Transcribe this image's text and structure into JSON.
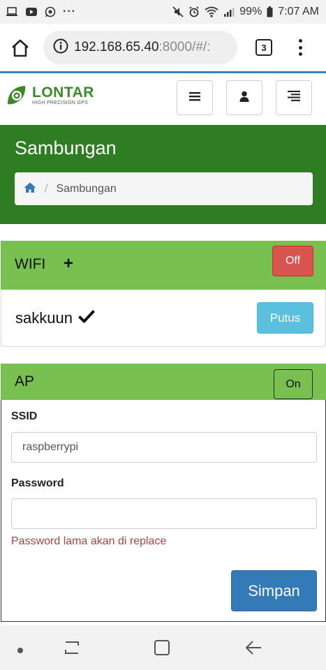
{
  "status_bar": {
    "left_icons": [
      "laptop-icon",
      "youtube-icon",
      "whatsapp-icon",
      "more-dots-icon"
    ],
    "more_dots": "···",
    "battery": "99%",
    "time": "7:07 AM"
  },
  "browser": {
    "url_host": "192.168.65.40",
    "url_path": ":8000/#/:",
    "tab_count": "3"
  },
  "app": {
    "logo_name": "LONTAR",
    "logo_sub": "HIGH PRECISION GPS"
  },
  "page": {
    "title": "Sambungan",
    "breadcrumb": [
      "Sambungan"
    ]
  },
  "wifi": {
    "title": "WIFI",
    "add_symbol": "+",
    "toggle_label": "Off",
    "connected_ssid": "sakkuun",
    "disconnect_label": "Putus"
  },
  "ap": {
    "title": "AP",
    "toggle_label": "On",
    "ssid_label": "SSID",
    "ssid_value": "raspberrypi",
    "password_label": "Password",
    "password_value": "",
    "password_help": "Password lama akan di replace",
    "save_label": "Simpan"
  },
  "colors": {
    "brand_green": "#2e7d22",
    "panel_green": "#78c150",
    "danger": "#d9534f",
    "info": "#5bc0de",
    "primary": "#337ab7"
  }
}
